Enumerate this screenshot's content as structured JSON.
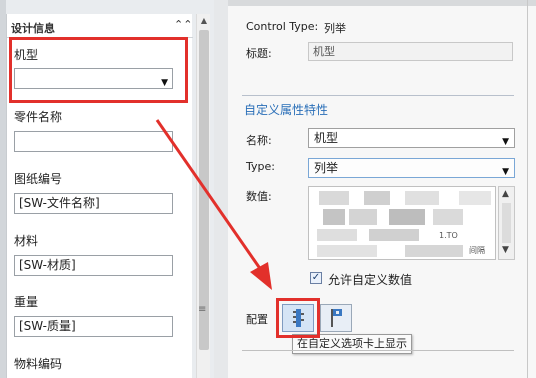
{
  "left_panel": {
    "section_title": "设计信息",
    "collapse_glyph": "⌃⌃",
    "fields": [
      {
        "label": "机型",
        "value": "",
        "type": "combo"
      },
      {
        "label": "零件名称",
        "value": "",
        "type": "text"
      },
      {
        "label": "图纸编号",
        "value": "[SW-文件名称]",
        "type": "text"
      },
      {
        "label": "材料",
        "value": "[SW-材质]",
        "type": "text"
      },
      {
        "label": "重量",
        "value": "[SW-质量]",
        "type": "text"
      },
      {
        "label": "物料编码",
        "value": "",
        "type": "text"
      }
    ],
    "scroll_grip": "≡"
  },
  "right_panel": {
    "control_type_label": "Control Type:",
    "control_type_value": "列举",
    "title_label": "标题:",
    "title_value": "机型",
    "section_title": "自定义属性特性",
    "name_label": "名称:",
    "name_value": "机型",
    "type_label": "Type:",
    "type_value": "列举",
    "values_label": "数值:",
    "values_fragment_1": "1.TO",
    "values_fragment_2": "间隔",
    "allow_custom_label": "允许自定义数值",
    "allow_custom_checked": true,
    "config_label": "配置",
    "tooltip_text": "在自定义选项卡上显示"
  },
  "glyphs": {
    "dropdown": "▼",
    "scroll_up": "▲",
    "scroll_down": "▼",
    "check": "✓"
  },
  "annotation_color": "#e2302b"
}
